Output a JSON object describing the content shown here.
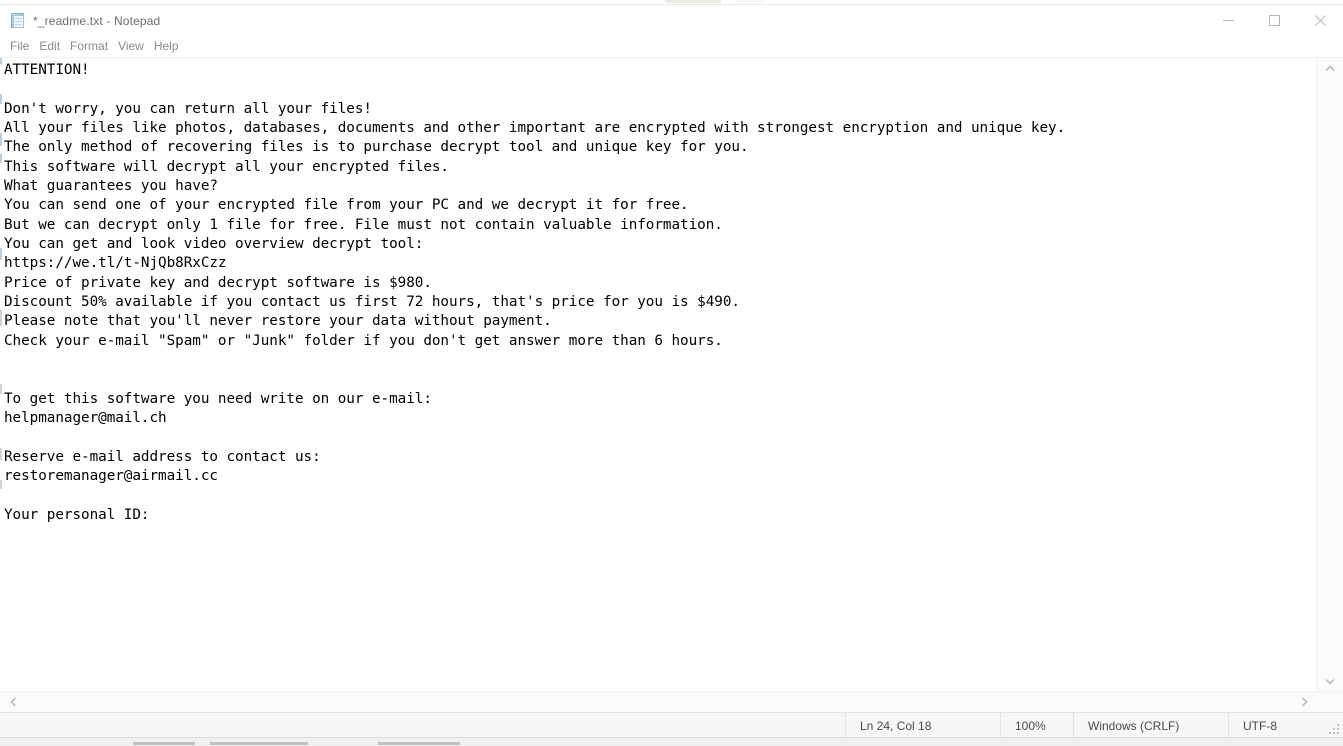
{
  "window": {
    "title": "*_readme.txt - Notepad",
    "app_icon": "notepad-icon"
  },
  "controls": {
    "minimize": "minimize-icon",
    "maximize": "maximize-icon",
    "close": "close-icon"
  },
  "menu": {
    "items": [
      {
        "label": "File"
      },
      {
        "label": "Edit"
      },
      {
        "label": "Format"
      },
      {
        "label": "View"
      },
      {
        "label": "Help"
      }
    ]
  },
  "document": {
    "lines": [
      "ATTENTION!",
      "",
      "Don't worry, you can return all your files!",
      "All your files like photos, databases, documents and other important are encrypted with strongest encryption and unique key.",
      "The only method of recovering files is to purchase decrypt tool and unique key for you.",
      "This software will decrypt all your encrypted files.",
      "What guarantees you have?",
      "You can send one of your encrypted file from your PC and we decrypt it for free.",
      "But we can decrypt only 1 file for free. File must not contain valuable information.",
      "You can get and look video overview decrypt tool:",
      "https://we.tl/t-NjQb8RxCzz",
      "Price of private key and decrypt software is $980.",
      "Discount 50% available if you contact us first 72 hours, that's price for you is $490.",
      "Please note that you'll never restore your data without payment.",
      "Check your e-mail \"Spam\" or \"Junk\" folder if you don't get answer more than 6 hours.",
      "",
      "",
      "To get this software you need write on our e-mail:",
      "helpmanager@mail.ch",
      "",
      "Reserve e-mail address to contact us:",
      "restoremanager@airmail.cc",
      "",
      "Your personal ID:"
    ]
  },
  "scrollbars": {
    "vertical": {
      "up_icon": "chevron-up-icon",
      "down_icon": "chevron-down-icon"
    },
    "horizontal": {
      "left_icon": "chevron-left-icon",
      "right_icon": "chevron-right-icon"
    }
  },
  "status_bar": {
    "cursor_position": "Ln 24, Col 18",
    "zoom": "100%",
    "line_ending": "Windows (CRLF)",
    "encoding": "UTF-8"
  },
  "colors": {
    "window_bg": "#ffffff",
    "text": "#000000",
    "title_text": "#6e6e6e",
    "menu_text": "#8a8a8a",
    "status_bg": "#f7f7f7",
    "status_text": "#4a4a4a",
    "icon_blue": "#9ec6dd"
  }
}
